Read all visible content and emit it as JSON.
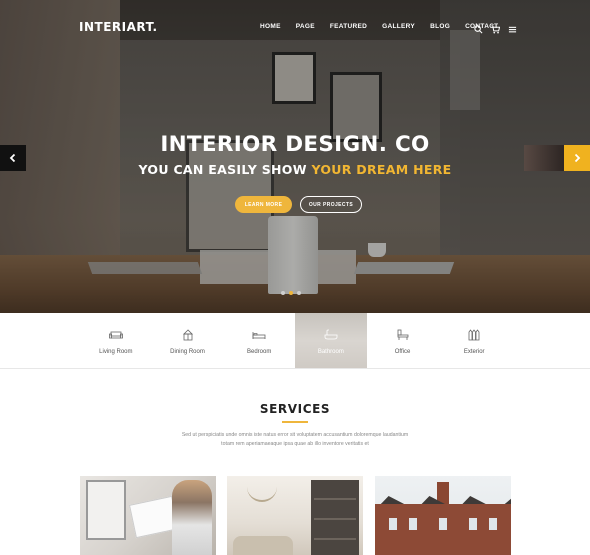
{
  "brand": {
    "logo": "INTERIART."
  },
  "nav": {
    "items": [
      "HOME",
      "PAGE",
      "FEATURED",
      "GALLERY",
      "BLOG",
      "CONTACT"
    ],
    "icons": [
      "search-icon",
      "cart-icon",
      "menu-icon"
    ]
  },
  "hero": {
    "title": "INTERIOR DESIGN. CO",
    "subtitle_prefix": "YOU CAN EASILY SHOW ",
    "subtitle_highlight": "YOUR DREAM HERE",
    "btn_primary": "LEARN MORE",
    "btn_secondary": "OUR PROJECTS",
    "slides_count": 3,
    "active_slide": 1,
    "accent_color": "#efb63c"
  },
  "categories": [
    {
      "label": "Living Room",
      "icon": "sofa-icon"
    },
    {
      "label": "Dining Room",
      "icon": "dining-icon"
    },
    {
      "label": "Bedroom",
      "icon": "bed-icon"
    },
    {
      "label": "Bathroom",
      "icon": "bath-icon",
      "active": true
    },
    {
      "label": "Office",
      "icon": "office-icon"
    },
    {
      "label": "Exterior",
      "icon": "exterior-icon"
    }
  ],
  "services": {
    "title": "SERVICES",
    "desc_line1": "Sed ut perspiciatis unde omnis iste natus error sit voluptatem accusantium doloremque laudantium",
    "desc_line2": "totam rem aperiamaeaque ipsa quae ab illo inventore veritatis et"
  }
}
